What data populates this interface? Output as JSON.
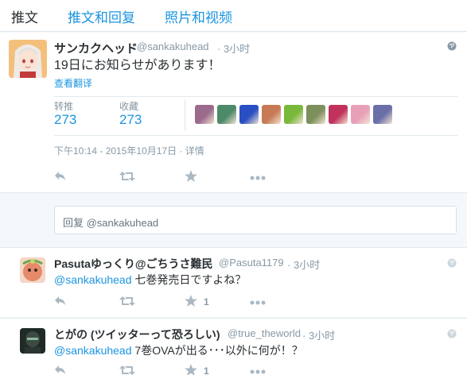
{
  "tabs": [
    {
      "label": "推文",
      "active": true
    },
    {
      "label": "推文和回复",
      "active": false
    },
    {
      "label": "照片和视频",
      "active": false
    }
  ],
  "main_tweet": {
    "author_name": "サンカクヘッド",
    "handle": "@sankakuhead",
    "time": "· 3小时",
    "text": "19日にお知らせがあります！",
    "translate": "查看翻译",
    "retweets_label": "转推",
    "retweets": "273",
    "favorites_label": "收藏",
    "favorites": "273",
    "timestamp": "下午10:14 - 2015年10月17日 · 详情",
    "favoriter_colors": [
      "#9a6b8c",
      "#4d8a6a",
      "#2a4fc2",
      "#c77a55",
      "#78b83a",
      "#7d8f5a",
      "#c0325c",
      "#e8a0b8",
      "#6a6fa8"
    ]
  },
  "reply_box": {
    "placeholder": "回复 @sankakuhead"
  },
  "replies": [
    {
      "author_name": "Pasutaゆっくり@ごちうさ難民",
      "handle": "@Pasuta1179",
      "time": "· 3小时",
      "mention": "@sankakuhead",
      "text": " 七巻発売日ですよね？",
      "favorites": "1",
      "avatar_color": "#e58a6a"
    },
    {
      "author_name": "とがの (ツイッターって恐ろしい)",
      "handle": "@true_theworld",
      "time": "· 3小时",
      "mention": "@sankakuhead",
      "text": " 7巻OVAが出る･･･以外に何が！？",
      "favorites": "1",
      "avatar_color": "#2d3a34"
    }
  ],
  "icons": {
    "reply": "reply-icon",
    "retweet": "retweet-icon",
    "favorite": "star-icon",
    "more": "more-icon",
    "globe": "globe-icon"
  },
  "colors": {
    "accent": "#1b95e0",
    "muted": "#8899a6",
    "icon": "#aab8c2"
  }
}
